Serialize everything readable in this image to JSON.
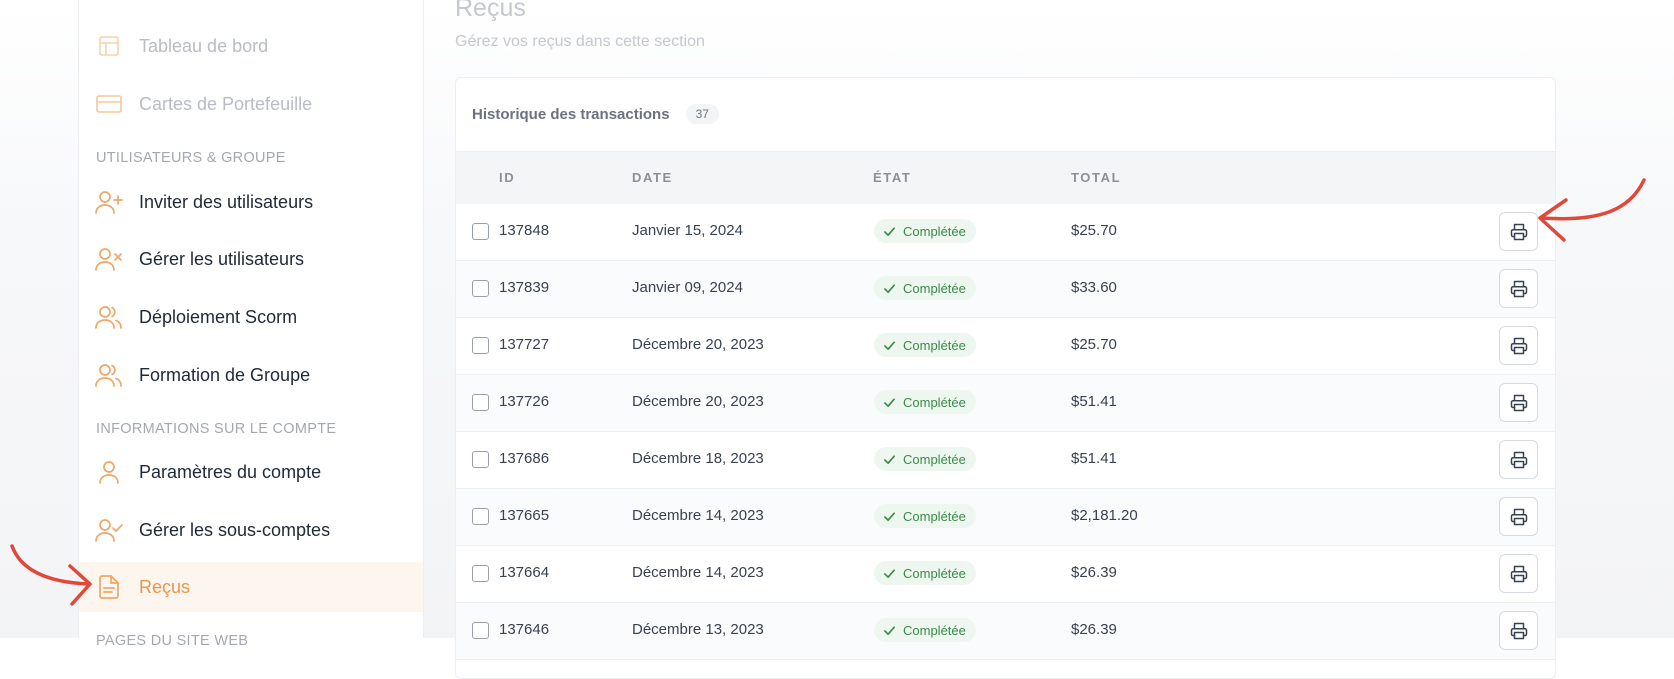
{
  "page": {
    "title": "Reçus",
    "subtitle": "Gérez vos reçus dans cette section"
  },
  "sidebar": {
    "items_top": [
      {
        "label": "Tableau de bord",
        "icon": "layout-icon"
      },
      {
        "label": "Cartes de Portefeuille",
        "icon": "credit-card-icon"
      }
    ],
    "section_users": "UTILISATEURS & GROUPE",
    "items_users": [
      {
        "label": "Inviter des utilisateurs",
        "icon": "user-plus-icon"
      },
      {
        "label": "Gérer les utilisateurs",
        "icon": "user-x-icon"
      },
      {
        "label": "Déploiement Scorm",
        "icon": "users-icon"
      },
      {
        "label": "Formation de Groupe",
        "icon": "users-icon"
      }
    ],
    "section_account": "INFORMATIONS SUR LE COMPTE",
    "items_account": [
      {
        "label": "Paramètres du compte",
        "icon": "user-icon"
      },
      {
        "label": "Gérer les sous-comptes",
        "icon": "user-check-icon"
      },
      {
        "label": "Reçus",
        "icon": "receipt-icon",
        "active": true
      }
    ],
    "section_web": "PAGES DU SITE WEB"
  },
  "transactions": {
    "title": "Historique des transactions",
    "count": "37",
    "columns": {
      "id": "ID",
      "date": "DATE",
      "status": "ÉTAT",
      "total": "TOTAL"
    },
    "rows": [
      {
        "id": "137848",
        "date": "Janvier 15, 2024",
        "status": "Complétée",
        "total": "$25.70"
      },
      {
        "id": "137839",
        "date": "Janvier 09, 2024",
        "status": "Complétée",
        "total": "$33.60"
      },
      {
        "id": "137727",
        "date": "Décembre 20, 2023",
        "status": "Complétée",
        "total": "$25.70"
      },
      {
        "id": "137726",
        "date": "Décembre 20, 2023",
        "status": "Complétée",
        "total": "$51.41"
      },
      {
        "id": "137686",
        "date": "Décembre 18, 2023",
        "status": "Complétée",
        "total": "$51.41"
      },
      {
        "id": "137665",
        "date": "Décembre 14, 2023",
        "status": "Complétée",
        "total": "$2,181.20"
      },
      {
        "id": "137664",
        "date": "Décembre 14, 2023",
        "status": "Complétée",
        "total": "$26.39"
      },
      {
        "id": "137646",
        "date": "Décembre 13, 2023",
        "status": "Complétée",
        "total": "$26.39"
      }
    ]
  },
  "colors": {
    "accent": "#e8954a",
    "annotation_arrow": "#e0493a",
    "status_green": "#3a8a4a"
  }
}
